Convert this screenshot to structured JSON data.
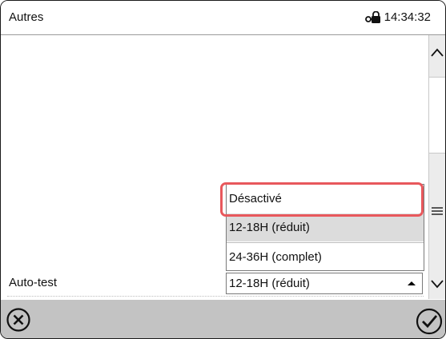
{
  "header": {
    "title": "Autres",
    "time": "14:34:32",
    "status_icon": "lock-key-icon"
  },
  "dropdown": {
    "options": [
      "Désactivé",
      "12-18H (réduit)",
      "24-36H (complet)"
    ],
    "highlighted_index": 0,
    "hover_index": 1
  },
  "setting": {
    "label": "Auto-test",
    "value": "12-18H (réduit)"
  },
  "scrollbar": {
    "up_icon": "chevron-up-icon",
    "menu_icon": "menu-icon",
    "down_icon": "chevron-down-icon"
  },
  "footer": {
    "cancel_icon": "cancel-icon",
    "confirm_icon": "check-icon"
  },
  "colors": {
    "highlight": "#e8585c",
    "footer_bg": "#c3c3c3",
    "hover_row": "#dcdcdc"
  }
}
